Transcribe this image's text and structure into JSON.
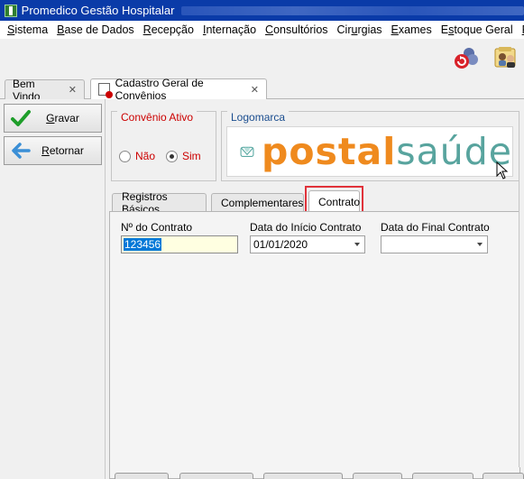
{
  "window": {
    "title": "Promedico Gestão Hospitalar"
  },
  "menu": [
    {
      "pre": "",
      "u": "S",
      "post": "istema"
    },
    {
      "pre": "",
      "u": "B",
      "post": "ase de Dados"
    },
    {
      "pre": "",
      "u": "R",
      "post": "ecepção"
    },
    {
      "pre": "",
      "u": "I",
      "post": "nternação"
    },
    {
      "pre": "",
      "u": "C",
      "post": "onsultórios"
    },
    {
      "pre": "Cir",
      "u": "u",
      "post": "rgias"
    },
    {
      "pre": "",
      "u": "E",
      "post": "xames"
    },
    {
      "pre": "E",
      "u": "s",
      "post": "toque Geral"
    },
    {
      "pre": "",
      "u": "P",
      "post": "..."
    }
  ],
  "toolbar": {
    "icons": [
      "refresh-icon",
      "users-icon"
    ]
  },
  "doc_tabs": [
    {
      "label": "Bem Vindo",
      "close": "✕"
    },
    {
      "label": "Cadastro Geral de Convênios",
      "close": "✕"
    }
  ],
  "side": {
    "save": {
      "u": "G",
      "post": "ravar",
      "icon": "check-icon",
      "color": "#1e9e2a"
    },
    "back": {
      "u": "R",
      "post": "etornar",
      "icon": "arrow-left-icon",
      "color": "#3b8fd6"
    }
  },
  "convenio_ativo": {
    "title": "Convênio Ativo",
    "options": [
      "Não",
      "Sim"
    ],
    "selected": "Sim"
  },
  "logomarca": {
    "title": "Logomarca",
    "logo_part1": "postal",
    "logo_part2": "saúde"
  },
  "inner_tabs": [
    "Registros Básicos",
    "Complementares",
    "Contrato"
  ],
  "active_inner_tab": "Contrato",
  "contrato": {
    "numero_label": "Nº do Contrato",
    "numero_value": "123456",
    "inicio_label": "Data do Início Contrato",
    "inicio_value": "01/01/2020",
    "final_label": "Data do Final Contrato",
    "final_value": ""
  }
}
